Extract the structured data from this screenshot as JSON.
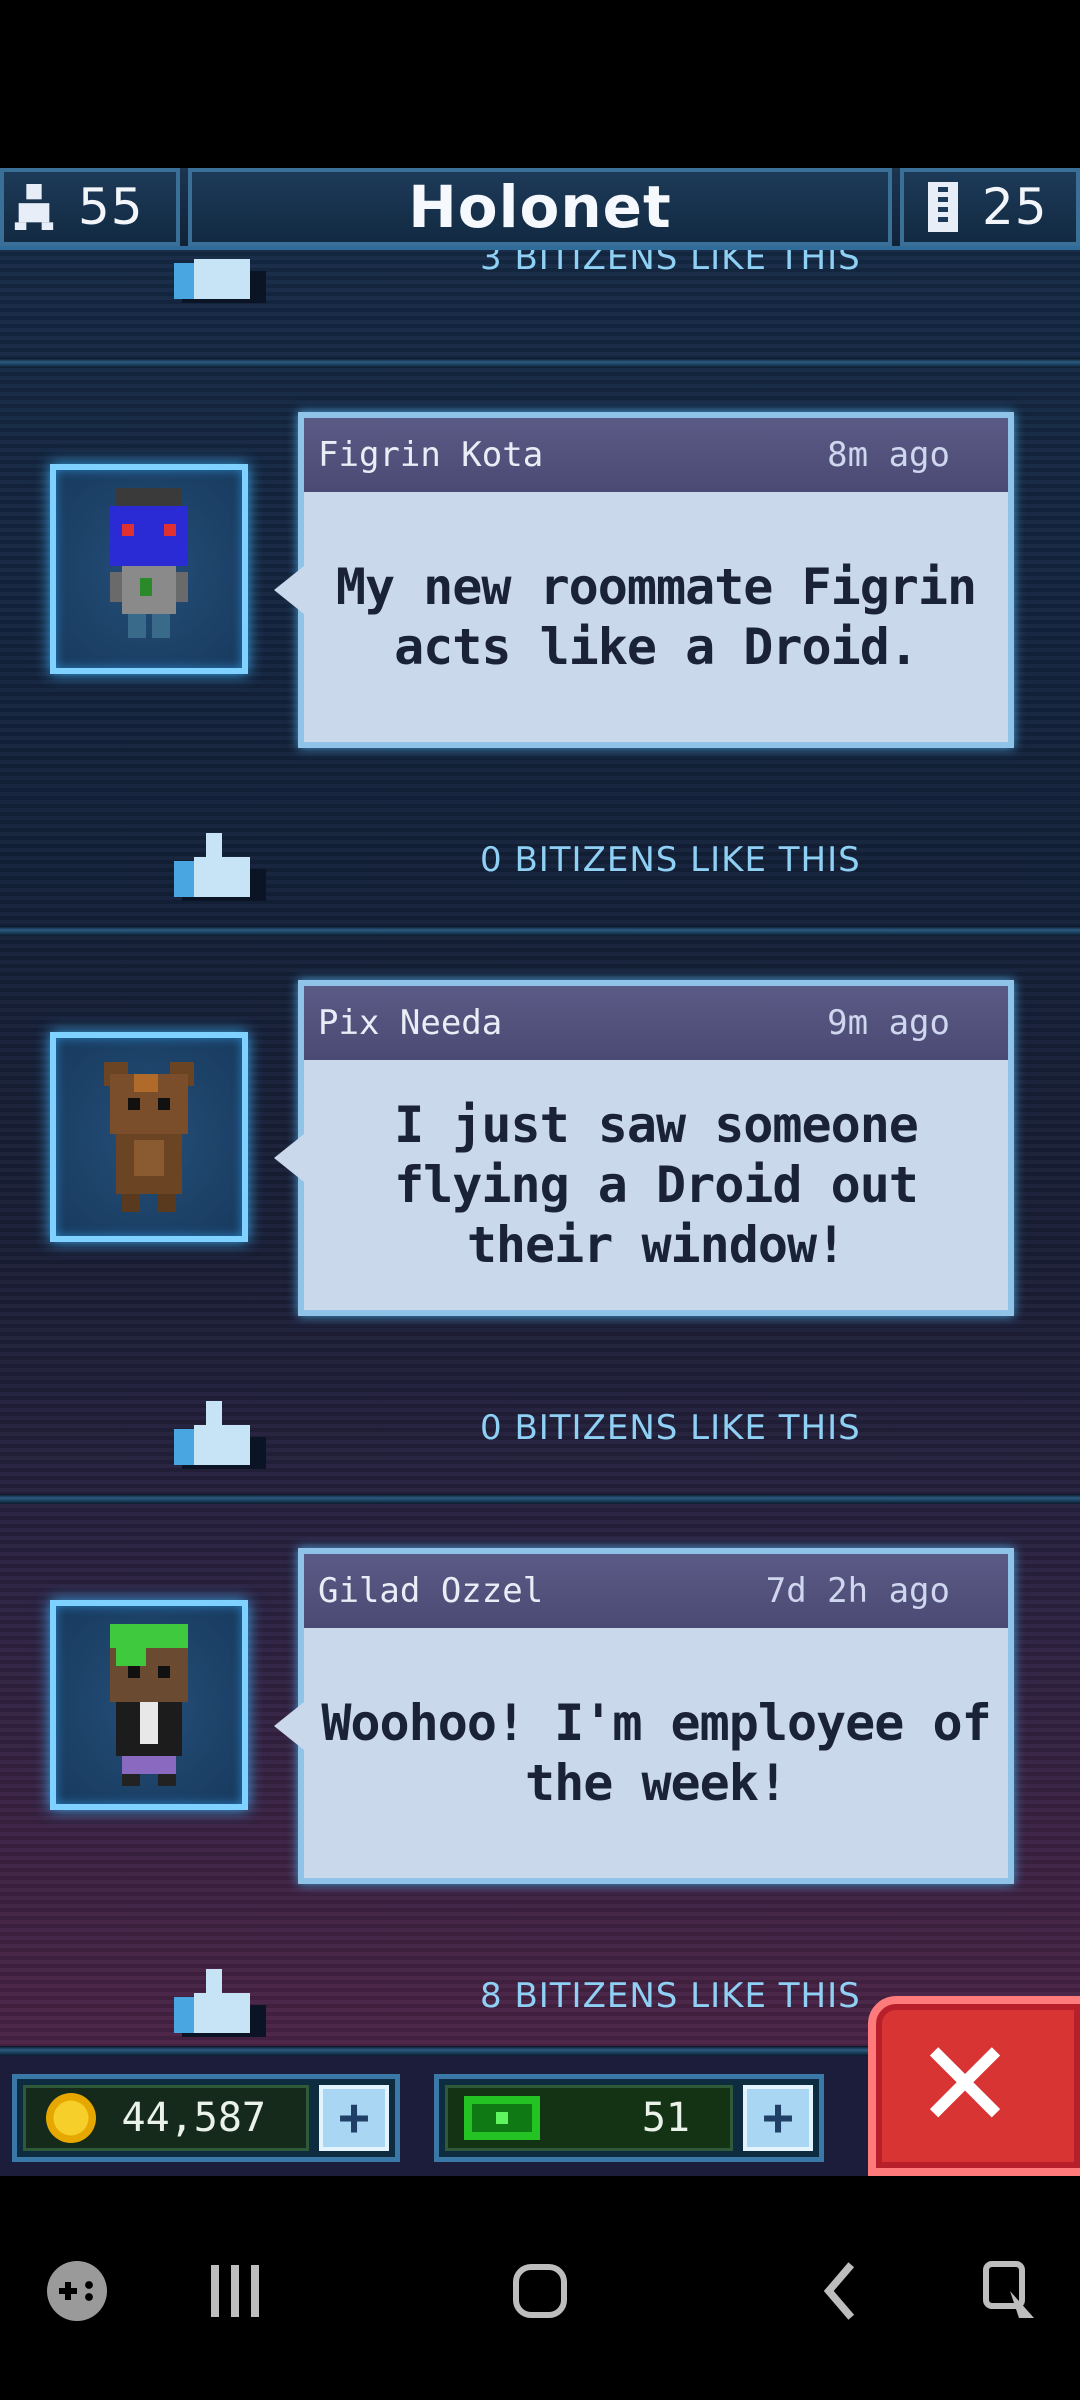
{
  "header": {
    "population": "55",
    "title": "Holonet",
    "floors": "25"
  },
  "feed": {
    "partial_post_likes": "3 BITIZENS LIKE THIS",
    "posts": [
      {
        "author": "Figrin Kota",
        "time": "8m ago",
        "message": "My new roommate Figrin acts like a Droid.",
        "likes": "0 BITIZENS LIKE THIS"
      },
      {
        "author": "Pix Needa",
        "time": "9m ago",
        "message": "I just saw someone flying a Droid out their window!",
        "likes": "0 BITIZENS LIKE THIS"
      },
      {
        "author": "Gilad Ozzel",
        "time": "7d 2h ago",
        "message": "Woohoo! I'm employee of the week!",
        "likes": "8 BITIZENS LIKE THIS"
      }
    ]
  },
  "hud": {
    "coins": "44,587",
    "bux": "51",
    "add_label": "+",
    "close_label": "✕"
  },
  "icons": {
    "population": "person-icon",
    "floors": "building-icon",
    "like": "thumbs-up-icon",
    "coin": "coin-icon",
    "bux": "bux-icon",
    "close": "close-icon"
  },
  "colors": {
    "accent": "#7fd2ff",
    "close": "#d83434",
    "bubble": "#c9d8ea"
  }
}
